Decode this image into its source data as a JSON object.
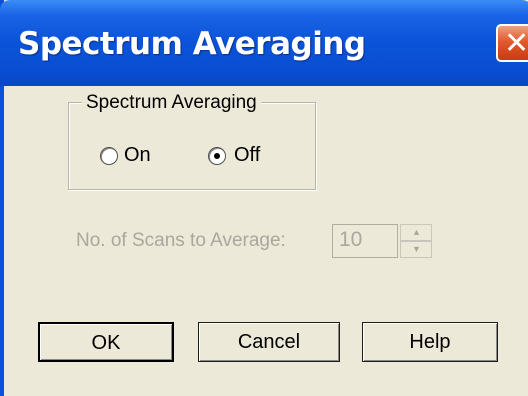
{
  "window": {
    "title": "Spectrum Averaging",
    "close_glyph": "✕"
  },
  "averaging": {
    "group_label": "Spectrum Averaging",
    "options": [
      {
        "label": "On",
        "checked": false
      },
      {
        "label": "Off",
        "checked": true
      }
    ]
  },
  "scans": {
    "label": "No. of Scans to Average:",
    "value": "10",
    "enabled": false
  },
  "buttons": {
    "ok": "OK",
    "cancel": "Cancel",
    "help": "Help"
  }
}
